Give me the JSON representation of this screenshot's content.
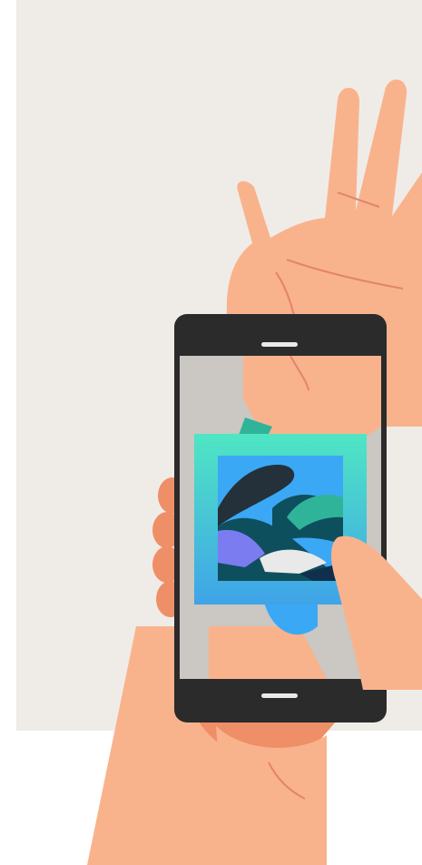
{
  "scene": {
    "description_icon": "phone-scanning-tattoo-illustration",
    "colors": {
      "background_panel": "#efece8",
      "skin": "#f9b38c",
      "skin_shadow": "#ef8f67",
      "skin_line": "#e2856a",
      "phone_body": "#2b2b2b",
      "phone_speaker": "#e9e9e9",
      "screen_bg": "#cbc7c2",
      "scan_gradient_top": "#4fe6c3",
      "scan_gradient_bottom": "#3fa4e8",
      "tattoo_blue": "#3aa8f5",
      "tattoo_dark": "#24303a",
      "tattoo_teal": "#0e4f5e",
      "tattoo_purple": "#7b7cf0",
      "tattoo_light": "#e9e9e9",
      "tattoo_green": "#2fb49a",
      "tattoo_navy": "#0f2f4d"
    }
  }
}
